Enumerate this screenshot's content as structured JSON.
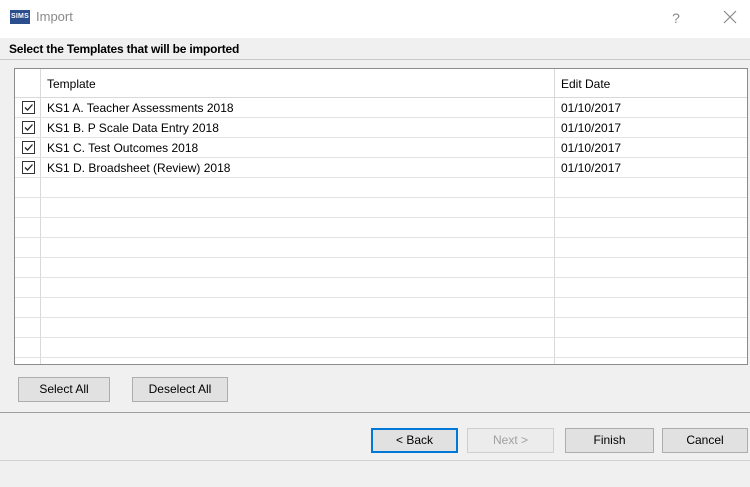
{
  "window": {
    "app_logo": "SIMS",
    "title": "Import",
    "help_label": "?"
  },
  "heading": "Select the Templates that will be imported",
  "grid": {
    "columns": [
      "Template",
      "Edit Date"
    ],
    "rows": [
      {
        "checked": true,
        "name": "KS1 A. Teacher Assessments 2018",
        "date": "01/10/2017"
      },
      {
        "checked": true,
        "name": "KS1 B. P Scale Data Entry 2018",
        "date": "01/10/2017"
      },
      {
        "checked": true,
        "name": "KS1 C. Test Outcomes 2018",
        "date": "01/10/2017"
      },
      {
        "checked": true,
        "name": "KS1 D. Broadsheet (Review) 2018",
        "date": "01/10/2017"
      }
    ],
    "empty_rows": 11
  },
  "buttons": {
    "select_all": "Select All",
    "deselect_all": "Deselect All",
    "back": "< Back",
    "next": "Next >",
    "finish": "Finish",
    "cancel": "Cancel"
  },
  "colors": {
    "logo_bg": "#2b4e8c",
    "default_button_border": "#0078d7",
    "panel_bg": "#f0f0f0"
  }
}
